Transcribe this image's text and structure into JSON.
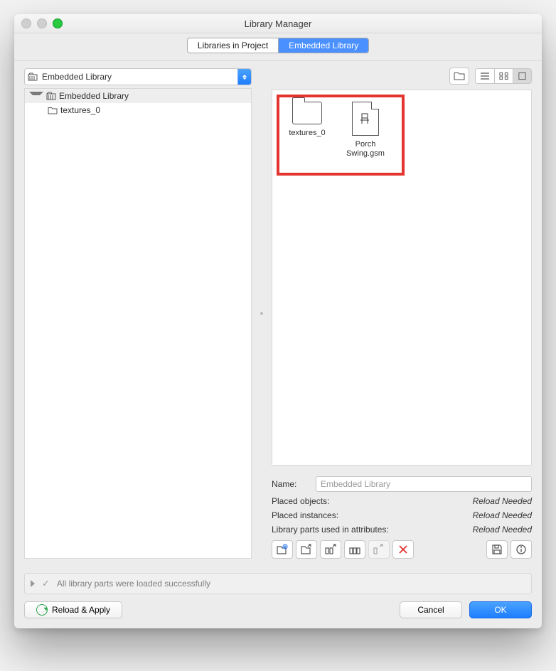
{
  "window": {
    "title": "Library Manager"
  },
  "tabs": {
    "left": "Libraries in Project",
    "right": "Embedded Library",
    "active": "right"
  },
  "popup": {
    "label": "Embedded Library"
  },
  "tree": {
    "root": {
      "label": "Embedded Library"
    },
    "children": [
      {
        "label": "textures_0"
      }
    ]
  },
  "view": {
    "active": "large"
  },
  "items": [
    {
      "kind": "folder",
      "label": "textures_0"
    },
    {
      "kind": "file",
      "label_line1": "Porch",
      "label_line2": "Swing.gsm"
    }
  ],
  "details": {
    "name_label": "Name:",
    "name_value": "Embedded Library",
    "rows": [
      {
        "label": "Placed objects:",
        "value": "Reload Needed"
      },
      {
        "label": "Placed instances:",
        "value": "Reload Needed"
      },
      {
        "label": "Library parts used in attributes:",
        "value": "Reload Needed"
      }
    ]
  },
  "status": {
    "message": "All library parts were loaded successfully"
  },
  "footer": {
    "reload": "Reload & Apply",
    "cancel": "Cancel",
    "ok": "OK"
  }
}
